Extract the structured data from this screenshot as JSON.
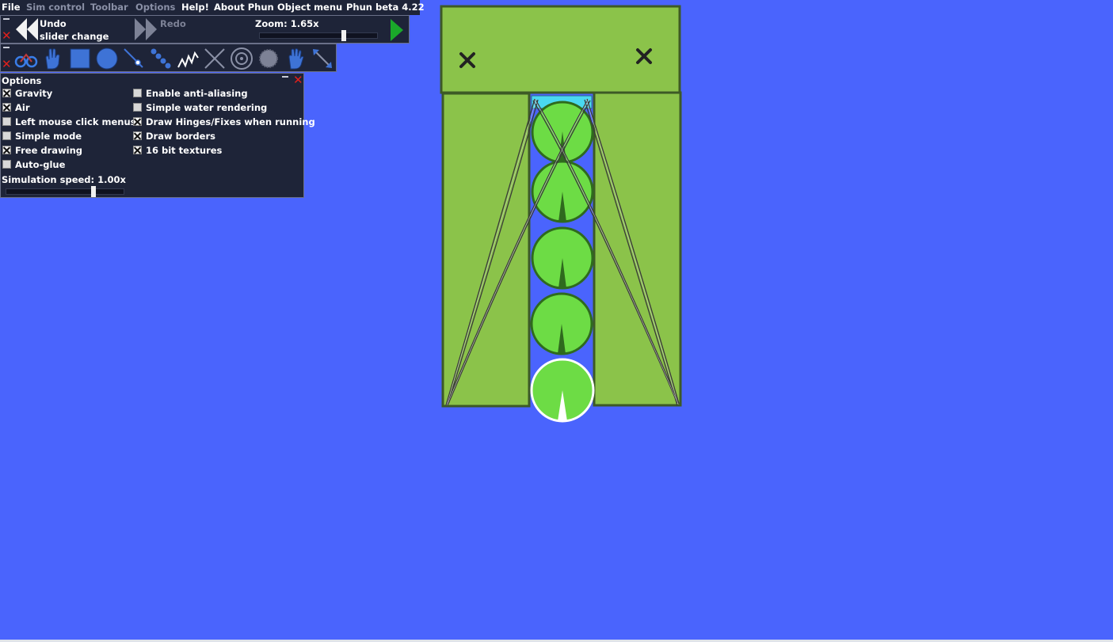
{
  "menu": {
    "items": [
      {
        "label": "File",
        "dim": false
      },
      {
        "label": "Sim control",
        "dim": true
      },
      {
        "label": "Toolbar",
        "dim": true
      },
      {
        "label": "Options",
        "dim": true
      },
      {
        "label": "Help!",
        "dim": false
      },
      {
        "label": "About Phun",
        "dim": false
      },
      {
        "label": "Object menu",
        "dim": false
      }
    ],
    "version": "Phun beta 4.22"
  },
  "undo_bar": {
    "undo_label_line1": "Undo",
    "undo_label_line2": "slider change",
    "redo_label": "Redo",
    "zoom_label": "Zoom: 1.65x",
    "zoom_fraction": 0.71
  },
  "toolbar": {
    "tools": [
      "bike-tool-icon",
      "drag-hand-icon",
      "box-tool-icon",
      "circle-tool-icon",
      "axle-tool-icon",
      "chain-tool-icon",
      "spring-tool-icon",
      "cut-tool-icon",
      "tracer-tool-icon",
      "brush-tool-icon",
      "glove-tool-icon",
      "scale-tool-icon"
    ]
  },
  "options": {
    "title": "Options",
    "left_column": [
      {
        "label": "Gravity",
        "checked": true
      },
      {
        "label": "Air",
        "checked": true
      },
      {
        "label": "Left mouse click menus",
        "checked": false
      },
      {
        "label": "Simple mode",
        "checked": false
      },
      {
        "label": "Free drawing",
        "checked": true
      },
      {
        "label": "Auto-glue",
        "checked": false
      }
    ],
    "right_column": [
      {
        "label": "Enable anti-aliasing",
        "checked": false
      },
      {
        "label": "Simple water rendering",
        "checked": false
      },
      {
        "label": "Draw Hinges/Fixes when running",
        "checked": true
      },
      {
        "label": "Draw borders",
        "checked": true
      },
      {
        "label": "16 bit textures",
        "checked": true
      }
    ],
    "sim_speed_label": "Simulation speed: 1.00x",
    "sim_speed_fraction": 0.74
  },
  "colors": {
    "background": "#4a64fd",
    "box_green": "#8bc34a",
    "box_border": "#3d5a26",
    "circle_green": "#6ddc45",
    "water": "#4ad8f0",
    "accent_red": "#e0201c",
    "play_green": "#1aa82a"
  }
}
